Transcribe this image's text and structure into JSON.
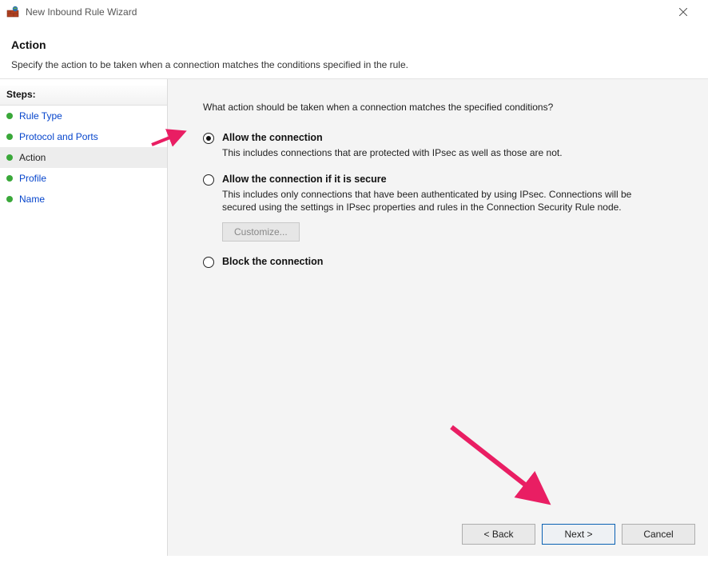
{
  "titlebar": {
    "title": "New Inbound Rule Wizard"
  },
  "header": {
    "title": "Action",
    "subtitle": "Specify the action to be taken when a connection matches the conditions specified in the rule."
  },
  "sidebar": {
    "heading": "Steps:",
    "items": [
      {
        "label": "Rule Type",
        "current": false
      },
      {
        "label": "Protocol and Ports",
        "current": false
      },
      {
        "label": "Action",
        "current": true
      },
      {
        "label": "Profile",
        "current": false
      },
      {
        "label": "Name",
        "current": false
      }
    ]
  },
  "content": {
    "prompt": "What action should be taken when a connection matches the specified conditions?",
    "options": [
      {
        "id": "allow",
        "title": "Allow the connection",
        "desc": "This includes connections that are protected with IPsec as well as those are not.",
        "checked": true
      },
      {
        "id": "allow-secure",
        "title": "Allow the connection if it is secure",
        "desc": "This includes only connections that have been authenticated by using IPsec.  Connections will be secured using the settings in IPsec properties and rules in the Connection Security Rule node.",
        "checked": false,
        "customize_label": "Customize..."
      },
      {
        "id": "block",
        "title": "Block the connection",
        "desc": "",
        "checked": false
      }
    ]
  },
  "footer": {
    "back": "< Back",
    "next": "Next >",
    "cancel": "Cancel"
  }
}
